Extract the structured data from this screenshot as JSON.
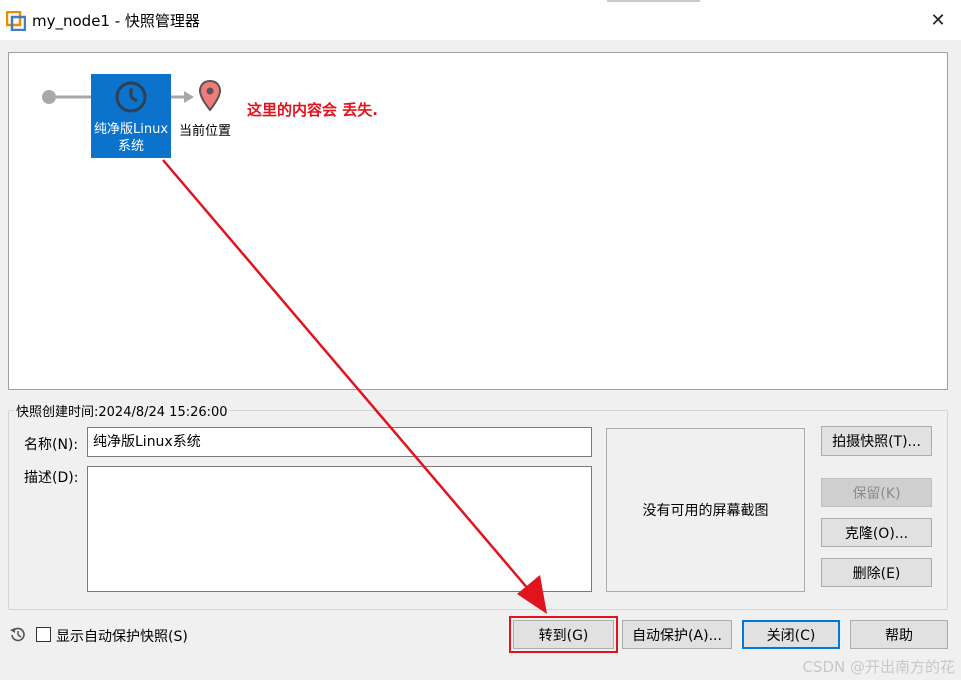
{
  "window": {
    "title": "my_node1 - 快照管理器",
    "close_label": "✕"
  },
  "tree": {
    "snapshot_label": "纯净版Linux系统",
    "current_label": "当前位置",
    "annotation": "这里的内容会 丢失."
  },
  "details": {
    "group_title": "快照创建时间:2024/8/24 15:26:00",
    "name_label": "名称(N):",
    "name_value": "纯净版Linux系统",
    "desc_label": "描述(D):",
    "desc_value": "",
    "screenshot_text": "没有可用的屏幕截图"
  },
  "side_buttons": {
    "take": "拍摄快照(T)...",
    "keep": "保留(K)",
    "clone": "克隆(O)...",
    "delete": "删除(E)"
  },
  "footer": {
    "show_autoprotect": "显示自动保护快照(S)",
    "goto": "转到(G)",
    "autoprotect": "自动保护(A)...",
    "close": "关闭(C)",
    "help": "帮助"
  },
  "watermark": "CSDN @开出南方的花",
  "colors": {
    "accent": "#0b73cc",
    "annotation": "#e0141e"
  }
}
